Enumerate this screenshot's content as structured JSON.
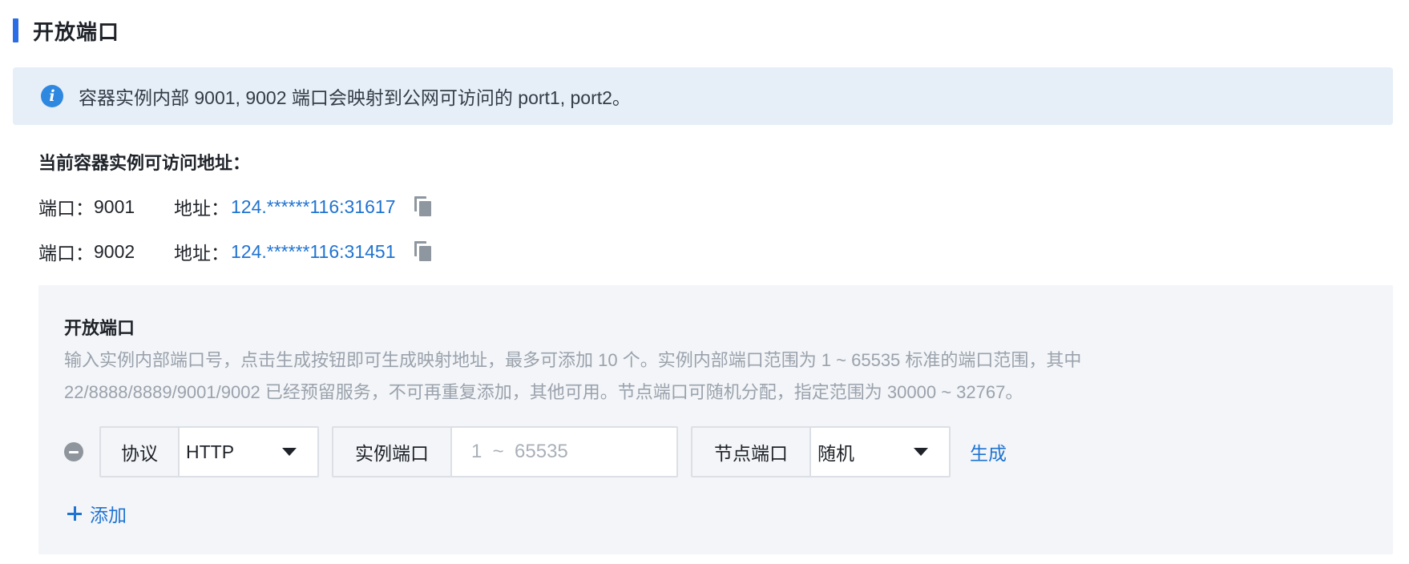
{
  "section": {
    "title": "开放端口"
  },
  "banner": {
    "icon": "info-icon",
    "text": "容器实例内部 9001, 9002 端口会映射到公网可访问的 port1, port2。"
  },
  "access": {
    "title": "当前容器实例可访问地址：",
    "port_label": "端口：",
    "address_label": "地址：",
    "rows": [
      {
        "port": "9001",
        "address": "124.******116:31617",
        "copy_icon": "copy-icon"
      },
      {
        "port": "9002",
        "address": "124.******116:31451",
        "copy_icon": "copy-icon"
      }
    ]
  },
  "panel": {
    "title": "开放端口",
    "description": "输入实例内部端口号，点击生成按钮即可生成映射地址，最多可添加 10 个。实例内部端口范围为 1 ~ 65535 标准的端口范围，其中 22/8888/8889/9001/9002 已经预留服务，不可再重复添加，其他可用。节点端口可随机分配，指定范围为 30000 ~ 32767。",
    "row": {
      "protocol_label": "协议",
      "protocol_value": "HTTP",
      "instance_port_label": "实例端口",
      "instance_port_placeholder": "1  ~  65535",
      "instance_port_value": "",
      "node_port_label": "节点端口",
      "node_port_value": "随机",
      "generate_label": "生成"
    },
    "add_label": "添加"
  },
  "colors": {
    "accent": "#2b6de5",
    "link": "#1f73d1",
    "banner_bg": "#e6eef7",
    "panel_bg": "#f3f5f8"
  }
}
